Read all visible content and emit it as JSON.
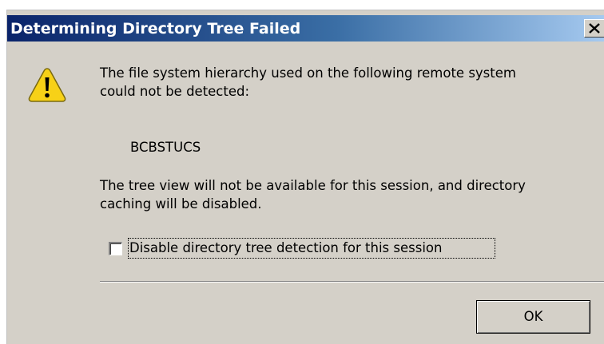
{
  "dialog": {
    "title": "Determining Directory Tree Failed",
    "close_icon": "close-icon",
    "warning_icon": "warning-icon",
    "message_line_1": "The file system hierarchy used on the following remote system",
    "message_line_2": "could not be detected:",
    "remote_system": "BCBSTUCS",
    "message_line_3": "The tree view will not be available for this session, and directory",
    "message_line_4": "caching will be disabled.",
    "checkbox_label": "Disable directory tree detection for this session",
    "checkbox_checked": false,
    "ok_label": "OK"
  },
  "colors": {
    "dialog_background": "#d4d0c8",
    "titlebar_start": "#0a246a",
    "titlebar_end": "#a6caf0",
    "warning_fill": "#f7d117"
  }
}
